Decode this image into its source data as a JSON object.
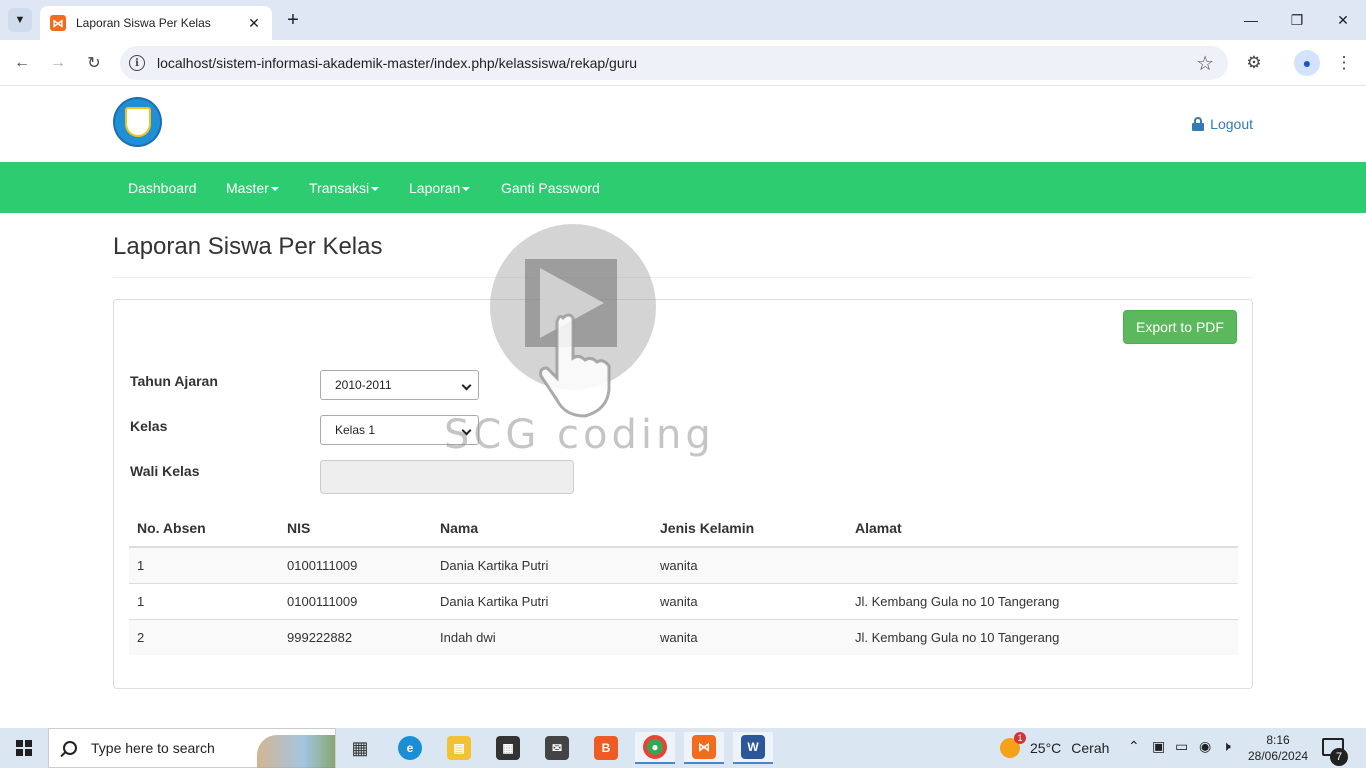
{
  "browser": {
    "tab_title": "Laporan Siswa Per Kelas",
    "url": "localhost/sistem-informasi-akademik-master/index.php/kelassiswa/rekap/guru"
  },
  "header": {
    "logout_label": "Logout"
  },
  "nav": {
    "items": [
      {
        "label": "Dashboard",
        "has_dropdown": false
      },
      {
        "label": "Master",
        "has_dropdown": true
      },
      {
        "label": "Transaksi",
        "has_dropdown": true
      },
      {
        "label": "Laporan",
        "has_dropdown": true
      },
      {
        "label": "Ganti Password",
        "has_dropdown": false
      }
    ],
    "color": "#2ecc71"
  },
  "page": {
    "title": "Laporan Siswa Per Kelas",
    "export_label": "Export to PDF",
    "form": {
      "tahun_label": "Tahun Ajaran",
      "tahun_value": "2010-2011",
      "kelas_label": "Kelas",
      "kelas_value": "Kelas 1",
      "wali_label": "Wali Kelas",
      "wali_value": ""
    },
    "table": {
      "headers": [
        "No. Absen",
        "NIS",
        "Nama",
        "Jenis Kelamin",
        "Alamat"
      ],
      "rows": [
        [
          "1",
          "0100111009",
          "Dania Kartika Putri",
          "wanita",
          ""
        ],
        [
          "1",
          "0100111009",
          "Dania Kartika Putri",
          "wanita",
          "Jl. Kembang Gula no 10 Tangerang"
        ],
        [
          "2",
          "999222882",
          "Indah dwi",
          "wanita",
          "Jl. Kembang Gula no 10 Tangerang"
        ]
      ]
    }
  },
  "watermark": {
    "text": "SCG coding"
  },
  "taskbar": {
    "search_placeholder": "Type here to search",
    "weather_temp": "25°C",
    "weather_desc": "Cerah",
    "weather_badge": "1",
    "time": "8:16",
    "date": "28/06/2024",
    "notification_count": "7"
  }
}
